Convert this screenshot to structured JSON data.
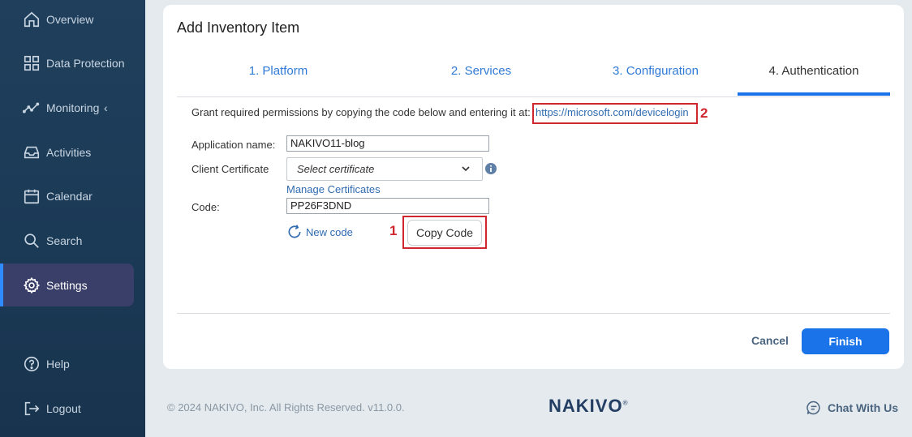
{
  "sidebar": {
    "items": [
      {
        "label": "Overview",
        "icon": "home-icon"
      },
      {
        "label": "Data Protection",
        "icon": "grid-icon"
      },
      {
        "label": "Monitoring",
        "icon": "activity-chart-icon"
      },
      {
        "label": "Activities",
        "icon": "inbox-icon"
      },
      {
        "label": "Calendar",
        "icon": "calendar-icon"
      },
      {
        "label": "Search",
        "icon": "search-icon"
      },
      {
        "label": "Settings",
        "icon": "gear-icon",
        "active": true
      },
      {
        "label": "Help",
        "icon": "help-icon"
      },
      {
        "label": "Logout",
        "icon": "logout-icon"
      }
    ]
  },
  "dialog": {
    "title": "Add Inventory Item",
    "tabs": [
      {
        "label": "1. Platform"
      },
      {
        "label": "2. Services"
      },
      {
        "label": "3. Configuration"
      },
      {
        "label": "4. Authentication",
        "active": true
      }
    ],
    "grant_text": "Grant required permissions by copying the code below and entering it at:",
    "device_login_link": "https://microsoft.com/devicelogin",
    "app_name_label": "Application name:",
    "app_name_value": "NAKIVO11-blog",
    "client_cert_label": "Client Certificate",
    "client_cert_value": "Select certificate",
    "manage_certificates": "Manage Certificates",
    "code_label": "Code:",
    "code_value": "PP26F3DND",
    "new_code": "New code",
    "copy_code": "Copy Code",
    "cancel": "Cancel",
    "finish": "Finish"
  },
  "annotations": {
    "marker_1": "1",
    "marker_2": "2",
    "color": "#d0262d"
  },
  "footer": {
    "copyright": "© 2024 NAKIVO, Inc. All Rights Reserved. v11.0.0.",
    "logo": "NAKIVO",
    "logo_mark": "®",
    "chat": "Chat With Us"
  },
  "colors": {
    "sidebar_bg": "#1f3f5c",
    "accent": "#1a73e8",
    "link": "#2f6bb0"
  }
}
